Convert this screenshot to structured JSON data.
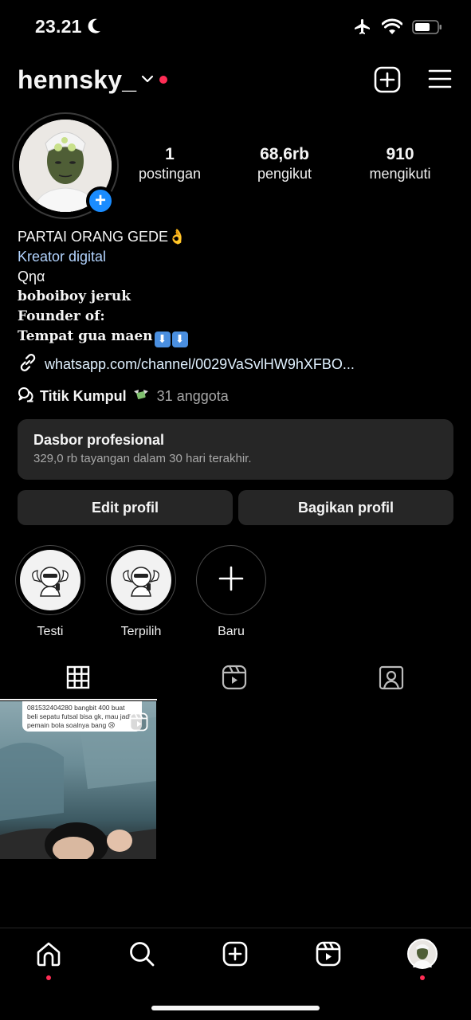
{
  "status_bar": {
    "time": "23.21"
  },
  "header": {
    "username": "hennsky_"
  },
  "profile": {
    "stats": [
      {
        "value": "1",
        "label": "postingan"
      },
      {
        "value": "68,6rb",
        "label": "pengikut"
      },
      {
        "value": "910",
        "label": "mengikuti"
      }
    ],
    "bio": {
      "name": "PARTAI ORANG GEDE",
      "name_emoji": "👌",
      "category": "Kreator digital",
      "lines": [
        "Qηα",
        "boboiboy jeruk",
        "Founder of:",
        "Tempat gua maen"
      ],
      "link": "whatsapp.com/channel/0029VaSvlHW9hXFBO...",
      "community_name": "Titik Kumpul",
      "community_members": "31 anggota"
    }
  },
  "dashboard": {
    "title": "Dasbor profesional",
    "subtitle": "329,0 rb tayangan dalam 30 hari terakhir."
  },
  "buttons": {
    "edit": "Edit profil",
    "share": "Bagikan profil"
  },
  "highlights": [
    {
      "label": "Testi"
    },
    {
      "label": "Terpilih"
    },
    {
      "label": "Baru"
    }
  ],
  "post": {
    "caption": "081532404280 bangbit 400 buat beli sepatu futsal bisa gk, mau jadi pemain bola soalnya bang 😢"
  },
  "colors": {
    "accent_blue": "#1a8cff",
    "notification_red": "#ff2d55",
    "link_blue": "#b3d4ff"
  }
}
